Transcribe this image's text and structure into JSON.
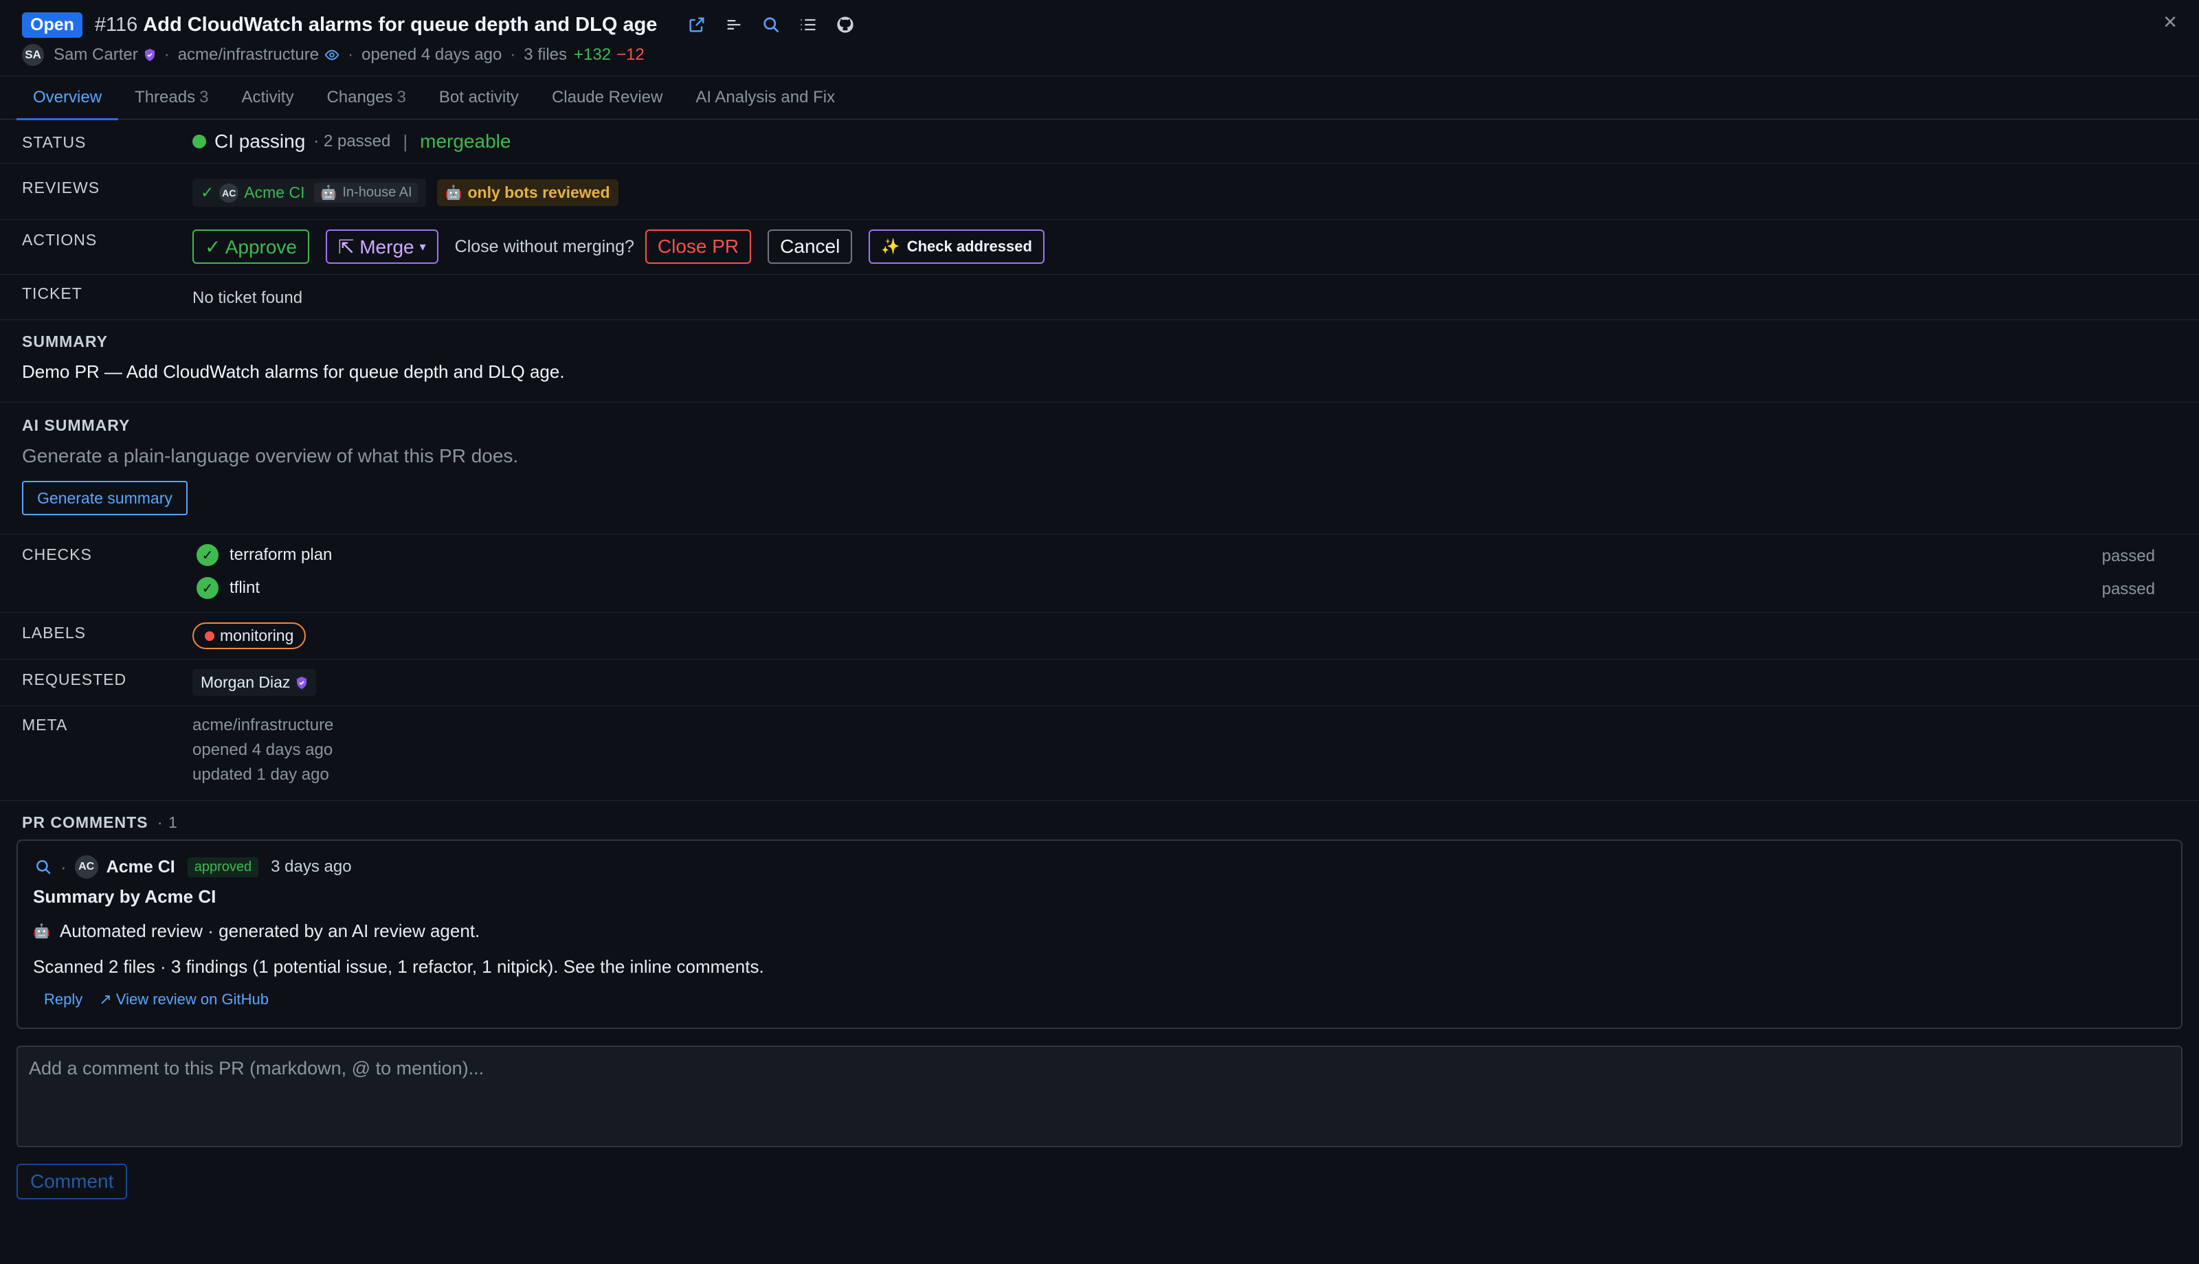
{
  "header": {
    "state": "Open",
    "number": "#116",
    "title": "Add CloudWatch alarms for queue depth and DLQ age",
    "author_initials": "SA",
    "author": "Sam Carter",
    "repo": "acme/infrastructure",
    "opened": "opened 4 days ago",
    "files": "3 files",
    "additions": "+132",
    "deletions": "−12"
  },
  "tabs": [
    {
      "label": "Overview",
      "count": ""
    },
    {
      "label": "Threads",
      "count": "3"
    },
    {
      "label": "Activity",
      "count": ""
    },
    {
      "label": "Changes",
      "count": "3"
    },
    {
      "label": "Bot activity",
      "count": ""
    },
    {
      "label": "Claude Review",
      "count": ""
    },
    {
      "label": "AI Analysis and Fix",
      "count": ""
    }
  ],
  "status": {
    "label": "STATUS",
    "ci": "CI passing",
    "passed": "· 2 passed",
    "sep": "|",
    "mergeable": "mergeable"
  },
  "reviews": {
    "label": "REVIEWS",
    "check": "✓",
    "reviewer_initials": "AC",
    "reviewer": "Acme CI",
    "reviewer_tag": "In-house AI",
    "warning": "only bots reviewed"
  },
  "actions": {
    "label": "ACTIONS",
    "approve": "✓ Approve",
    "merge": "⇱ Merge",
    "merge_caret": "▾",
    "close_prompt": "Close without merging?",
    "close_pr": "Close PR",
    "cancel": "Cancel",
    "check_addressed": "Check addressed",
    "sparkle": "✨"
  },
  "ticket": {
    "label": "TICKET",
    "value": "No ticket found"
  },
  "summary": {
    "label": "SUMMARY",
    "text": "Demo PR — Add CloudWatch alarms for queue depth and DLQ age."
  },
  "ai_summary": {
    "label": "AI SUMMARY",
    "hint": "Generate a plain-language overview of what this PR does.",
    "button": "Generate summary"
  },
  "checks": {
    "label": "CHECKS",
    "items": [
      {
        "name": "terraform plan",
        "result": "passed"
      },
      {
        "name": "tflint",
        "result": "passed"
      }
    ]
  },
  "labels": {
    "label": "LABELS",
    "items": [
      "monitoring"
    ]
  },
  "requested": {
    "label": "REQUESTED",
    "reviewer": "Morgan Diaz"
  },
  "meta": {
    "label": "META",
    "repo": "acme/infrastructure",
    "opened": "opened 4 days ago",
    "updated": "updated 1 day ago"
  },
  "pr_comments": {
    "heading": "PR COMMENTS",
    "count": "· 1",
    "comment": {
      "author_initials": "AC",
      "author": "Acme CI",
      "badge": "approved",
      "time": "3 days ago",
      "title": "Summary by Acme CI",
      "line1": "Automated review · generated by an AI review agent.",
      "line2": "Scanned 2 files · 3 findings (1 potential issue, 1 refactor, 1 nitpick). See the inline comments.",
      "reply": "Reply",
      "view": "↗ View review on GitHub"
    }
  },
  "composer": {
    "placeholder": "Add a comment to this PR (markdown, @ to mention)...",
    "button": "Comment"
  },
  "colors": {
    "accent": "#1f6feb",
    "success": "#3fb950",
    "danger": "#f85149",
    "purple": "#a371f7",
    "warning": "#e3b341"
  }
}
